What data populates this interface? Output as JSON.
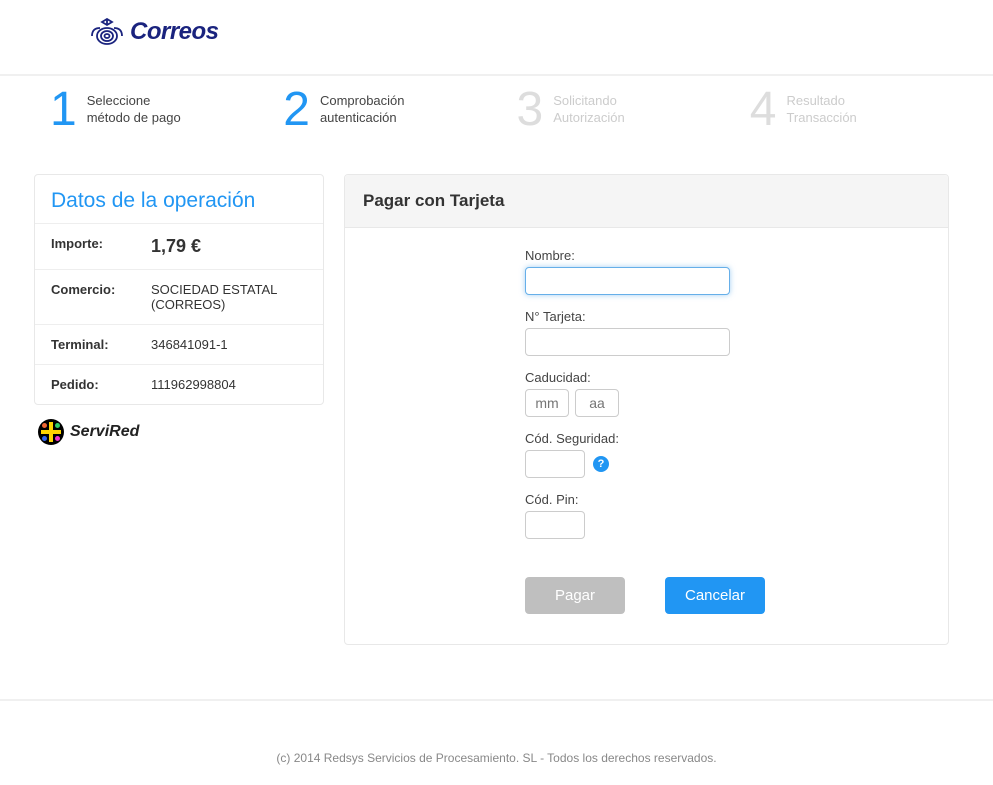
{
  "brand": "Correos",
  "steps": [
    {
      "num": "1",
      "line1": "Seleccione",
      "line2": "método de pago",
      "active": true
    },
    {
      "num": "2",
      "line1": "Comprobación",
      "line2": "autenticación",
      "active": true
    },
    {
      "num": "3",
      "line1": "Solicitando",
      "line2": "Autorización",
      "active": false
    },
    {
      "num": "4",
      "line1": "Resultado",
      "line2": "Transacción",
      "active": false
    }
  ],
  "operation_panel": {
    "title": "Datos de la operación",
    "rows": {
      "importe_label": "Importe:",
      "importe_value": "1,79 €",
      "comercio_label": "Comercio:",
      "comercio_value": "SOCIEDAD ESTATAL (CORREOS)",
      "terminal_label": "Terminal:",
      "terminal_value": "346841091-1",
      "pedido_label": "Pedido:",
      "pedido_value": "111962998804"
    }
  },
  "servired_label": "ServiRed",
  "card_form": {
    "title": "Pagar con Tarjeta",
    "name_label": "Nombre:",
    "name_value": "",
    "card_label": "N° Tarjeta:",
    "card_value": "",
    "expiry_label": "Caducidad:",
    "expiry_mm_placeholder": "mm",
    "expiry_mm_value": "",
    "expiry_yy_placeholder": "aa",
    "expiry_yy_value": "",
    "cvv_label": "Cód. Seguridad:",
    "cvv_value": "",
    "help_icon": "?",
    "pin_label": "Cód. Pin:",
    "pin_value": "",
    "pay_button": "Pagar",
    "cancel_button": "Cancelar"
  },
  "footer": "(c) 2014 Redsys Servicios de Procesamiento. SL - Todos los derechos reservados."
}
